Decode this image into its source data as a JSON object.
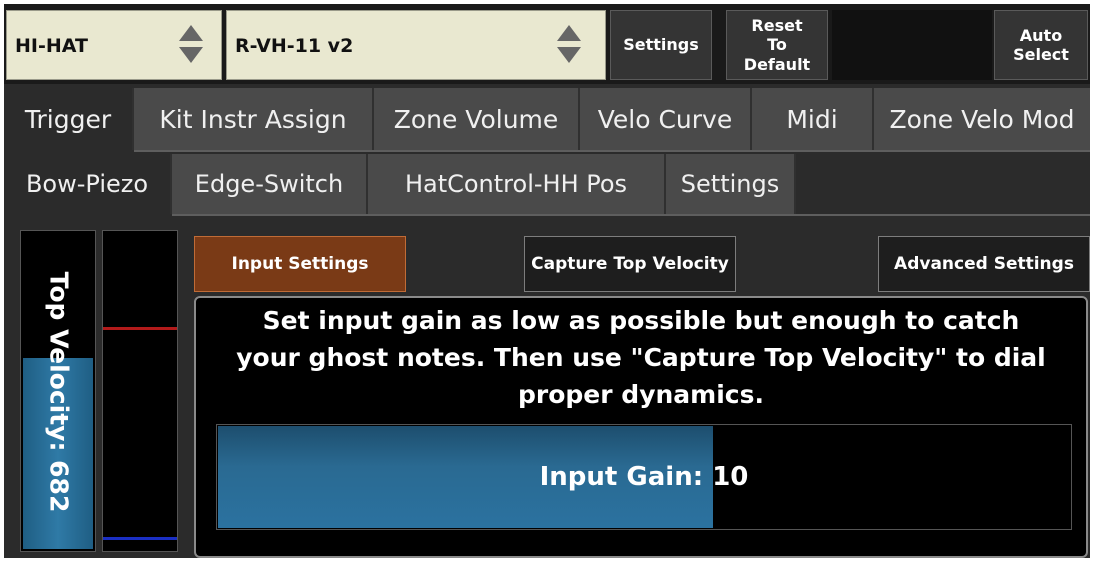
{
  "top": {
    "instrument": "HI-HAT",
    "model": "R-VH-11 v2",
    "settings_label": "Settings",
    "reset_label": "Reset\nTo\nDefault",
    "auto_select_label": "Auto\nSelect"
  },
  "tabs_row1": [
    {
      "label": "Trigger",
      "active": true
    },
    {
      "label": "Kit Instr Assign",
      "active": false
    },
    {
      "label": "Zone Volume",
      "active": false
    },
    {
      "label": "Velo Curve",
      "active": false
    },
    {
      "label": "Midi",
      "active": false
    },
    {
      "label": "Zone Velo Mod",
      "active": false
    }
  ],
  "tabs_row2": [
    {
      "label": "Bow-Piezo",
      "active": true
    },
    {
      "label": "Edge-Switch",
      "active": false
    },
    {
      "label": "HatControl-HH Pos",
      "active": false
    },
    {
      "label": "Settings",
      "active": false
    }
  ],
  "meter": {
    "label": "Top Velocity: 682",
    "fill_fraction": 0.61,
    "red_line_fraction": 0.69,
    "blue_line_fraction": 0.035
  },
  "sub_buttons": {
    "input_settings": "Input Settings",
    "capture_top_velocity": "Capture Top Velocity",
    "advanced_settings": "Advanced Settings"
  },
  "instructions": "Set input gain as low as possible but enough to catch your ghost notes. Then use \"Capture Top Velocity\" to dial proper dynamics.",
  "gain": {
    "label": "Input Gain:",
    "value": "10",
    "fill_fraction": 0.58
  },
  "colors": {
    "accent_active": "#7a3a16",
    "gain_fill": "#2b72a0",
    "dropdown_bg": "#e9e8d0"
  }
}
